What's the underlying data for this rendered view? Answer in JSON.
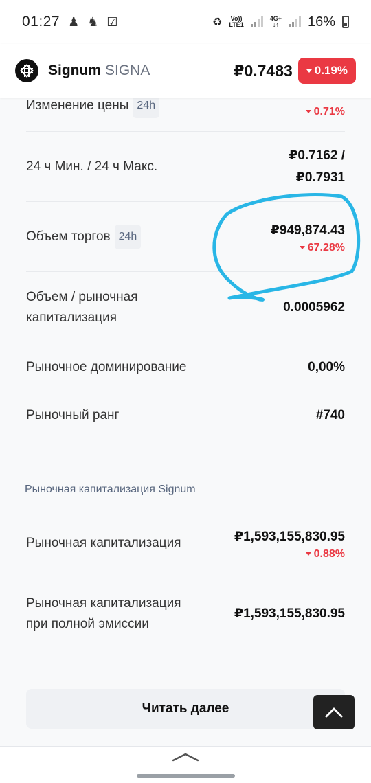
{
  "status_bar": {
    "time": "01:27",
    "icons": [
      "chess-pawn-icon",
      "chess-knight-icon",
      "checkbox-icon"
    ],
    "volte_top": "Vo))",
    "volte_bottom": "LTE1",
    "net_top": "4G+",
    "net_bottom": "↓↑",
    "battery": "16%"
  },
  "header": {
    "name": "Signum",
    "ticker": "SIGNA",
    "price": "₽0.7483",
    "change": "0.19%",
    "change_direction": "down",
    "down_color": "#ea3943"
  },
  "stats": [
    {
      "label": "Изменение цены",
      "tag": "24h",
      "value": "",
      "change": "0.71%"
    },
    {
      "label": "24 ч Мин. / 24 ч Макс.",
      "value_line1": "₽0.7162 /",
      "value_line2": "₽0.7931"
    },
    {
      "label": "Объем торгов",
      "tag": "24h",
      "value": "₽949,874.43",
      "change": "67.28%"
    },
    {
      "label_line1": "Объем / рыночная",
      "label_line2": "капитализация",
      "value": "0.0005962"
    },
    {
      "label": "Рыночное доминирование",
      "value": "0,00%"
    },
    {
      "label": "Рыночный ранг",
      "value": "#740"
    }
  ],
  "market_cap_section": {
    "title": "Рыночная капитализация Signum",
    "rows": [
      {
        "label": "Рыночная капитализация",
        "value": "₽1,593,155,830.95",
        "change": "0.88%"
      },
      {
        "label_line1": "Рыночная капитализация",
        "label_line2": "при полной эмиссии",
        "value": "₽1,593,155,830.95"
      }
    ]
  },
  "read_more_label": "Читать далее",
  "annotation_color": "#29b6e6"
}
